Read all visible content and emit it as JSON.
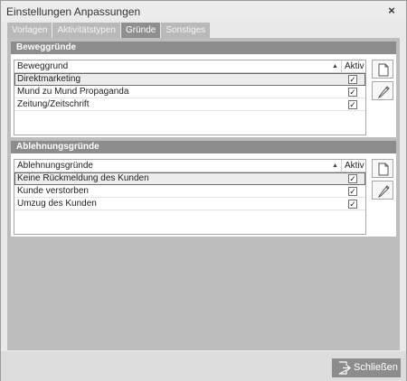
{
  "window": {
    "title": "Einstellungen Anpassungen",
    "close_glyph": "×"
  },
  "tabs": [
    {
      "label": "Vorlagen",
      "active": false
    },
    {
      "label": "Aktivitätstypen",
      "active": false
    },
    {
      "label": "Gründe",
      "active": true
    },
    {
      "label": "Sonstiges",
      "active": false
    }
  ],
  "groups": {
    "beweg": {
      "header": "Beweggründe",
      "col_name": "Beweggrund",
      "col_aktiv": "Aktiv",
      "sort_glyph": "▲",
      "rows": [
        {
          "name": "Direktmarketing",
          "aktiv": "✓"
        },
        {
          "name": "Mund zu Mund Propaganda",
          "aktiv": "✓"
        },
        {
          "name": "Zeitung/Zeitschrift",
          "aktiv": "✓"
        }
      ]
    },
    "ablehn": {
      "header": "Ablehnungsgründe",
      "col_name": "Ablehnungsgründe",
      "col_aktiv": "Aktiv",
      "sort_glyph": "▲",
      "rows": [
        {
          "name": "Keine Rückmeldung des Kunden",
          "aktiv": "✓"
        },
        {
          "name": "Kunde verstorben",
          "aktiv": "✓"
        },
        {
          "name": "Umzug des Kunden",
          "aktiv": "✓"
        }
      ]
    }
  },
  "footer": {
    "close_label": "Schließen"
  },
  "icons": {
    "new": "new-document-icon",
    "edit": "pencil-icon",
    "close": "exit-icon"
  },
  "colors": {
    "header_bg": "#8c8c8c",
    "active_tab": "#8f8f8f",
    "tab": "#b9b9b9"
  }
}
